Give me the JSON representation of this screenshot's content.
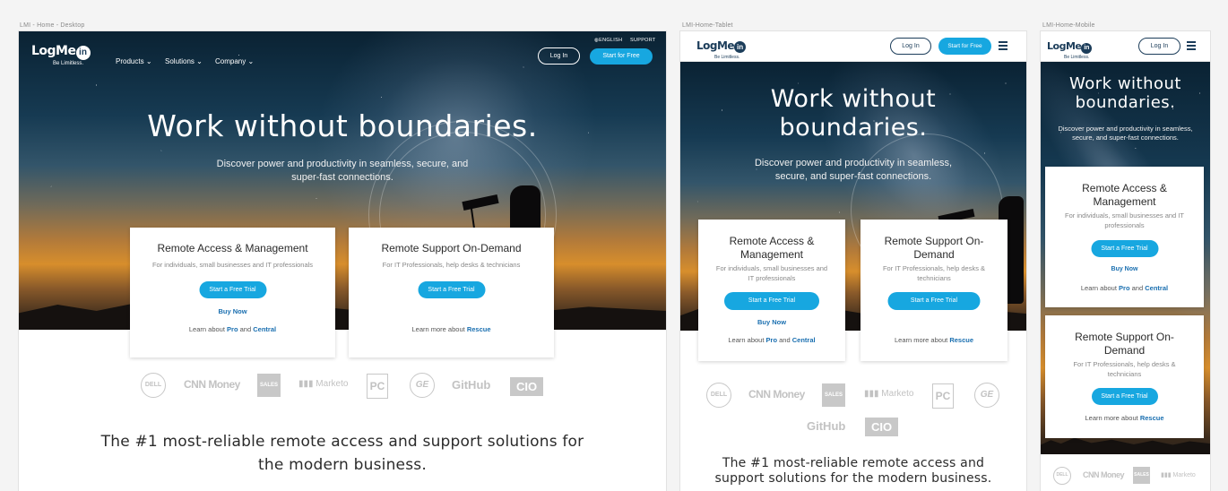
{
  "frames": {
    "desktop_label": "LMI - Home - Desktop",
    "tablet_label": "LMI-Home-Tablet",
    "mobile_label": "LMI-Home-Mobile"
  },
  "brand": {
    "word": "LogMe",
    "in": "in",
    "tagline": "Be Limitless.",
    "accent_color": "#17a7e0",
    "navy_color": "#1c3d5a"
  },
  "nav": {
    "products": "Products",
    "solutions": "Solutions",
    "company": "Company",
    "chevron": "⌄",
    "language": "ENGLISH",
    "support": "SUPPORT",
    "login": "Log In",
    "start": "Start for Free",
    "globe_icon": "globe-icon"
  },
  "hero": {
    "title": "Work without boundaries.",
    "title_tablet_1": "Work without",
    "title_tablet_2": "boundaries.",
    "subtitle_desktop_1": "Discover power and productivity in seamless, secure, and",
    "subtitle_desktop_2": "super-fast connections.",
    "subtitle_tablet_1": "Discover power and productivity in seamless,",
    "subtitle_tablet_2": "secure, and super-fast connections.",
    "subtitle_mobile_1": "Discover power and productivity in seamless,",
    "subtitle_mobile_2": "secure, and super-fast connections."
  },
  "cards": {
    "remote_access": {
      "title": "Remote Access & Management",
      "title_1": "Remote Access &",
      "title_2": "Management",
      "desc": "For individuals, small businesses and IT professionals",
      "desc_1": "For individuals, small businesses and",
      "desc_2": "IT professionals",
      "desc_m1": "For individuals, small businesses and IT",
      "desc_m2": "professionals",
      "cta": "Start a Free Trial",
      "buy": "Buy Now",
      "learn_prefix": "Learn about",
      "pro": "Pro",
      "and": "and",
      "central": "Central"
    },
    "remote_support": {
      "title": "Remote Support On-Demand",
      "title_1": "Remote Support On-",
      "title_2": "Demand",
      "desc": "For IT Professionals, help desks & technicians",
      "desc_1": "For IT Professionals, help desks &",
      "desc_2": "technicians",
      "cta": "Start a Free Trial",
      "learn_prefix": "Learn more about",
      "rescue": "Rescue"
    }
  },
  "clients": {
    "dell": "DELL",
    "cnn": "CNN Money",
    "sales": "SALES",
    "marketo": "Marketo",
    "pc": "PC",
    "ge": "GE",
    "github": "GitHub",
    "cio": "CIO"
  },
  "tagline": {
    "desktop_1": "The #1 most-reliable remote access and support solutions for",
    "desktop_2": "the modern business.",
    "tablet_1": "The #1 most-reliable remote access and",
    "tablet_2": "support solutions for the modern business."
  }
}
